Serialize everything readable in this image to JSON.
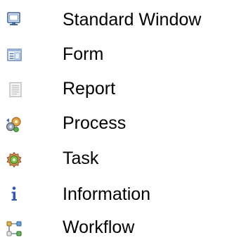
{
  "menu": {
    "items": [
      {
        "label": "Standard Window",
        "icon": "window-icon"
      },
      {
        "label": "Form",
        "icon": "form-icon"
      },
      {
        "label": "Report",
        "icon": "report-icon"
      },
      {
        "label": "Process",
        "icon": "process-icon"
      },
      {
        "label": "Task",
        "icon": "task-icon"
      },
      {
        "label": "Information",
        "icon": "info-icon"
      },
      {
        "label": "Workflow",
        "icon": "workflow-icon"
      }
    ]
  }
}
